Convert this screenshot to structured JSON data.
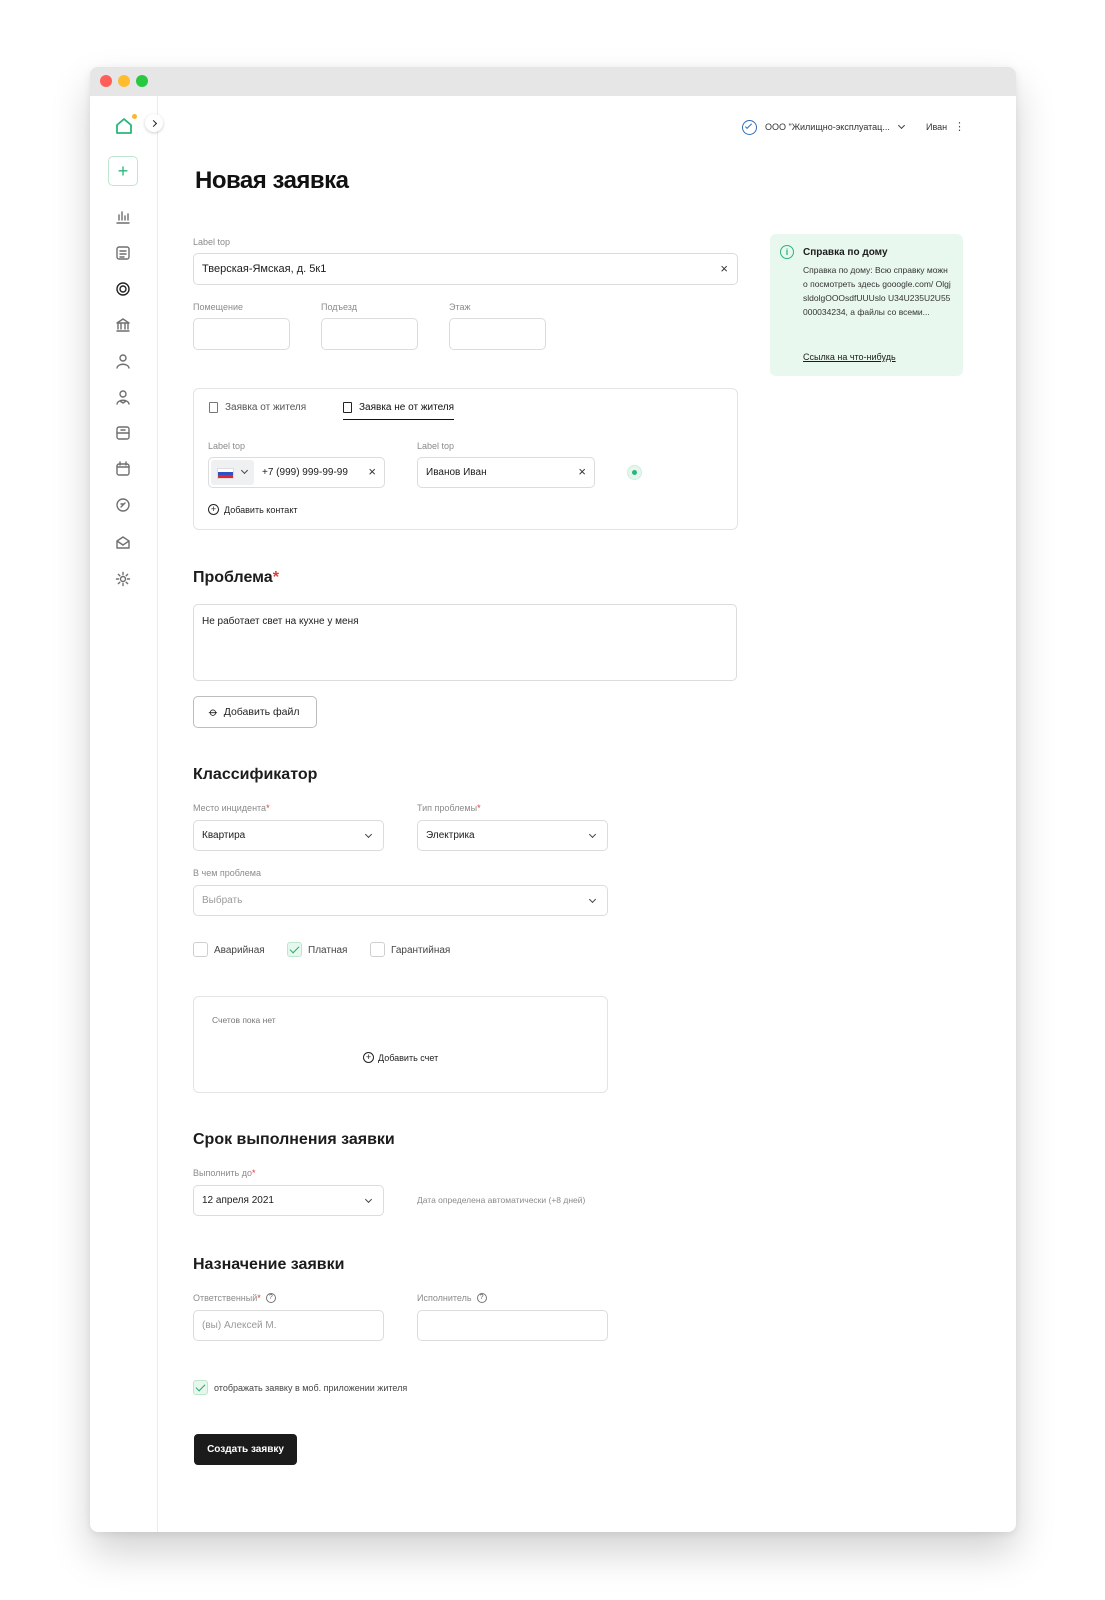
{
  "window": {
    "dots": [
      "#ff5f57",
      "#febc2e",
      "#28c840"
    ]
  },
  "topbar": {
    "org": "ООО \"Жилищно-эксплуатац...",
    "user": "Иван",
    "menu_glyph": "⋮"
  },
  "sidebar": {
    "icons": [
      "home-logo-icon",
      "chevron-right-icon",
      "plus-icon",
      "chart-icon",
      "list-icon",
      "target-icon",
      "bank-icon",
      "user-icon",
      "users-icon",
      "document-icon",
      "calendar-icon",
      "money-icon",
      "mail-icon",
      "gear-icon"
    ],
    "add_glyph": "+"
  },
  "page": {
    "title": "Новая заявка"
  },
  "address": {
    "label": "Label top",
    "value": "Тверская-Ямская, д. 5к1"
  },
  "room": {
    "label": "Помещение",
    "value": ""
  },
  "entrance": {
    "label": "Подъезд",
    "value": ""
  },
  "floor": {
    "label": "Этаж",
    "value": ""
  },
  "info": {
    "title": "Справка по дому",
    "text": "Справка по дому: Всю справку можно посмотреть здесь gooogle.com/ OlgjsldolgOOOsdfUUUslo U34U235U2U55000034234, а файлы со всеми...",
    "link": "Ссылка на что-нибудь"
  },
  "contact": {
    "tabs": [
      "Заявка от жителя",
      "Заявка не от жителя"
    ],
    "phone_label": "Label top",
    "phone": "+7 (999) 999-99-99",
    "name_label": "Label top",
    "name": "Иванов Иван",
    "add": "Добавить контакт"
  },
  "problem": {
    "title": "Проблема",
    "required": "*",
    "text": "Не работает свет на кухне у меня",
    "add_file": "Добавить файл"
  },
  "classifier": {
    "title": "Классификатор",
    "place_label": "Место инцидента",
    "place": "Квартира",
    "type_label": "Тип проблемы",
    "type": "Электрика",
    "what_label": "В чем проблема",
    "what": "Выбрать",
    "req": "*",
    "checks": [
      {
        "label": "Аварийная",
        "checked": false
      },
      {
        "label": "Платная",
        "checked": true
      },
      {
        "label": "Гарантийная",
        "checked": false
      }
    ]
  },
  "invoices": {
    "empty": "Счетов пока нет",
    "add": "Добавить счет"
  },
  "deadline": {
    "title": "Срок выполнения заявки",
    "label": "Выполнить до",
    "req": "*",
    "value": "12 апреля 2021",
    "note": "Дата определена автоматически (+8 дней)"
  },
  "assign": {
    "title": "Назначение заявки",
    "resp_label": "Ответственный",
    "req": "*",
    "resp_placeholder": "(вы) Алексей М.",
    "exec_label": "Исполнитель",
    "help_glyph": "?"
  },
  "mobile": {
    "label": "отображать заявку в моб. приложении жителя",
    "checked": true
  },
  "submit": "Создать заявку"
}
